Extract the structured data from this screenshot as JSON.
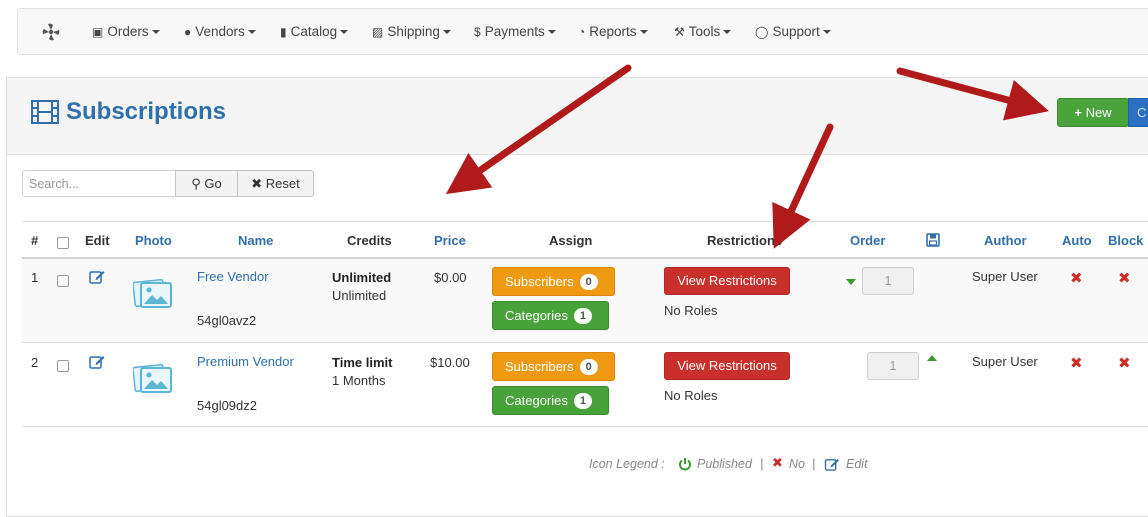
{
  "nav": {
    "logo_icon": "pinwheel-icon",
    "items": [
      {
        "label": "Orders",
        "icon": "money-icon"
      },
      {
        "label": "Vendors",
        "icon": "user-icon"
      },
      {
        "label": "Catalog",
        "icon": "bookmark-icon"
      },
      {
        "label": "Shipping",
        "icon": "truck-icon"
      },
      {
        "label": "Payments",
        "icon": "dollar-icon"
      },
      {
        "label": "Reports",
        "icon": "pie-chart-icon"
      },
      {
        "label": "Tools",
        "icon": "wrench-icon"
      },
      {
        "label": "Support",
        "icon": "lifebuoy-icon"
      }
    ]
  },
  "page": {
    "title": "Subscriptions",
    "title_icon": "film-icon",
    "new_label": "New",
    "second_label": "C"
  },
  "search": {
    "placeholder": "Search...",
    "go_label": "Go",
    "reset_label": "Reset"
  },
  "table": {
    "headers": {
      "num": "#",
      "edit": "Edit",
      "photo": "Photo",
      "name": "Name",
      "credits": "Credits",
      "price": "Price",
      "assign": "Assign",
      "restrictions": "Restrictions",
      "order": "Order",
      "author": "Author",
      "auto": "Auto",
      "block": "Block"
    },
    "rows": [
      {
        "num": "1",
        "name": "Free Vendor",
        "code": "54gl0avz2",
        "credits_type": "Unlimited",
        "credits_value": "Unlimited",
        "price": "$0.00",
        "subscribers_label": "Subscribers",
        "subscribers_count": "0",
        "categories_label": "Categories",
        "categories_count": "1",
        "restrictions_label": "View Restrictions",
        "roles": "No Roles",
        "order": "1",
        "author": "Super User"
      },
      {
        "num": "2",
        "name": "Premium Vendor",
        "code": "54gl09dz2",
        "credits_type": "Time limit",
        "credits_value": "1 Months",
        "price": "$10.00",
        "subscribers_label": "Subscribers",
        "subscribers_count": "0",
        "categories_label": "Categories",
        "categories_count": "1",
        "restrictions_label": "View Restrictions",
        "roles": "No Roles",
        "order": "1",
        "author": "Super User"
      }
    ]
  },
  "legend": {
    "label": "Icon Legend :",
    "published": "Published",
    "no": "No",
    "edit": "Edit",
    "sep": "|"
  },
  "colors": {
    "link": "#2f6fad",
    "green": "#48a23a",
    "orange": "#ef9a12",
    "red": "#c9302c",
    "annotation_arrow": "#b01a1a"
  }
}
